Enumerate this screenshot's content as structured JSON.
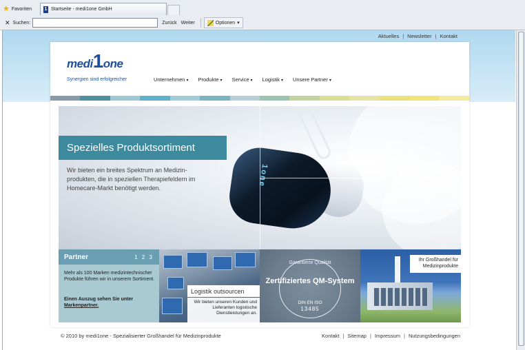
{
  "browser": {
    "favorites_label": "Favoriten",
    "tab_title": "Startseite - medi1one GmbH",
    "tab_icon_letter": "1",
    "search_label": "Suchen:",
    "search_value": "",
    "back_label": "Zurück",
    "forward_label": "Weiter",
    "options_label": "Optionen",
    "close_symbol": "✕"
  },
  "site": {
    "top_links": [
      "Aktuelles",
      "Newsletter",
      "Kontakt"
    ],
    "logo_left": "medi",
    "logo_num": "1",
    "logo_right": "one",
    "tagline": "Synergien sind erfolgreicher",
    "nav": [
      "Unternehmen",
      "Produkte",
      "Service",
      "Logistik",
      "Unsere Partner"
    ],
    "stripe_colors": [
      "#8a9aa6",
      "#4e8fa2",
      "#9fc7d6",
      "#5fb0c9",
      "#a4cbd8",
      "#7ab3c1",
      "#b6cfd6",
      "#9cc4b3",
      "#c2d4a0",
      "#d9de95",
      "#e8e3a3",
      "#ece07c",
      "#f0e57a",
      "#f4ea9e"
    ],
    "hero": {
      "title": "Spezielles Produktsortiment",
      "text": "Wir bieten ein breites Spektrum an Medizin-produkten, die in speziellen Therapiefeldern im Homecare-Markt benötigt werden.",
      "device_label": "1one"
    },
    "tiles": {
      "partner": {
        "title": "Partner",
        "pages": "1 2 3",
        "body": "Mehr als 100 Marken medizintechnischer Produkte führen wir in unserem Sortiment.",
        "link_prefix": "Einen Auszug sehen Sie unter",
        "link_text": "Markenpartner."
      },
      "logistik": {
        "title": "Logistik outsourcen",
        "text": "Wir bieten unseren Kunden und Lieferanten logistische Dienstleistungen an."
      },
      "quality": {
        "top": "Garantierte Qualität",
        "main": "Zertifiziertes QM-System",
        "norm": "DIN EN ISO",
        "number": "13485"
      },
      "wholesale": {
        "text": "Ihr Großhandel für Medizinprodukte"
      }
    },
    "footer": {
      "copyright": "© 2010 by medi1one - Spezialisierter Großhandel für Medizinprodukte",
      "links": [
        "Kontakt",
        "Sitemap",
        "Impressum",
        "Nutzungsbedingungen"
      ]
    }
  }
}
